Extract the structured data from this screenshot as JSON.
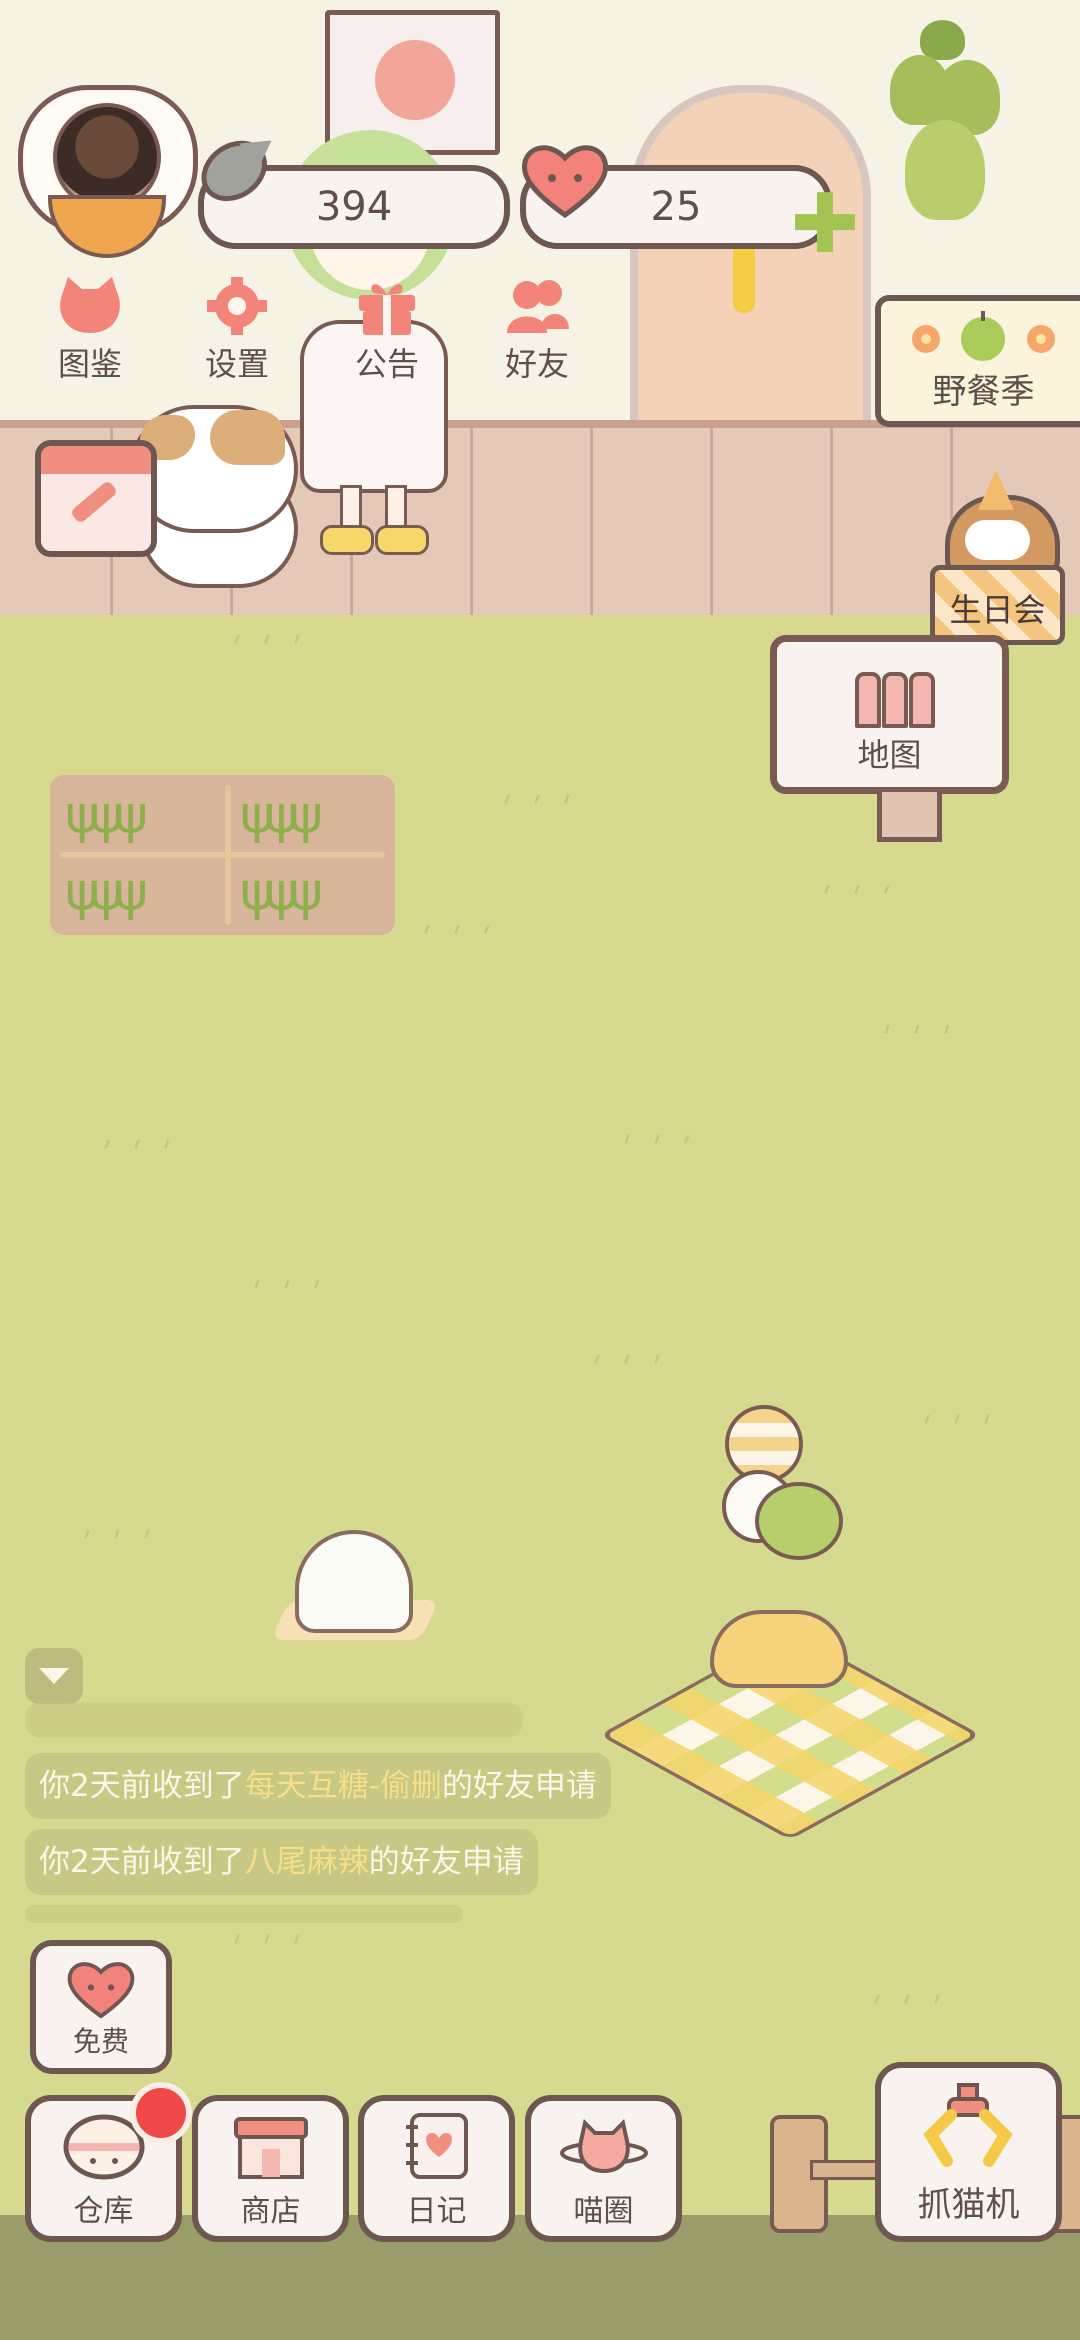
{
  "hud": {
    "fish_count": "394",
    "heart_count": "25"
  },
  "menu": [
    {
      "label": "图鉴",
      "icon": "cat-head-icon"
    },
    {
      "label": "设置",
      "icon": "gear-icon"
    },
    {
      "label": "公告",
      "icon": "gift-icon"
    },
    {
      "label": "好友",
      "icon": "friends-icon"
    }
  ],
  "events": {
    "picnic_season": "野餐季",
    "birthday_party": "生日会",
    "map": "地图"
  },
  "messages": [
    {
      "prefix": "你2天前收到了",
      "name": "每天互糖-偷删",
      "suffix": "的好友申请"
    },
    {
      "prefix": "你2天前收到了",
      "name": "八尾麻辣",
      "suffix": "的好友申请"
    }
  ],
  "bottom": {
    "free": "免费",
    "warehouse": "仓库",
    "shop": "商店",
    "diary": "日记",
    "meow_circle": "喵圈",
    "claw_machine": "抓猫机"
  },
  "colors": {
    "grass": "#d6da8f",
    "accent_pink": "#f08f80",
    "outline": "#6e5750",
    "notify_red": "#f0494a",
    "friend_name": "#f6df8a"
  }
}
